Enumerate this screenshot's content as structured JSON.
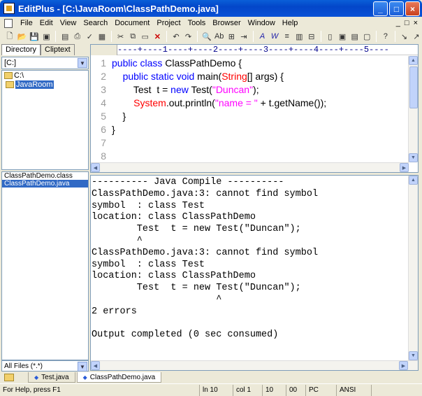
{
  "window": {
    "title": "EditPlus - [C:\\JavaRoom\\ClassPathDemo.java]"
  },
  "menu": [
    "File",
    "Edit",
    "View",
    "Search",
    "Document",
    "Project",
    "Tools",
    "Browser",
    "Window",
    "Help"
  ],
  "mdi_buttons": [
    "_",
    "□",
    "×"
  ],
  "panel": {
    "tabs": [
      "Directory",
      "Cliptext"
    ],
    "drive": "[C:]",
    "tree": [
      "C:\\",
      "JavaRoom"
    ],
    "files": [
      "ClassPathDemo.class",
      "ClassPathDemo.java"
    ],
    "filter": "All Files (*.*)"
  },
  "editor": {
    "ruler": "----+----1----+----2----+----3----+----4----+----5----",
    "line_numbers": [
      "1",
      "2",
      "3",
      "4",
      "5",
      "6",
      "7",
      "8"
    ],
    "lines": [
      {
        "parts": [
          [
            "kw",
            "public class "
          ],
          [
            "",
            "ClassPathDemo {"
          ]
        ]
      },
      {
        "parts": [
          [
            "",
            "    "
          ],
          [
            "kw",
            "public static void "
          ],
          [
            "",
            "main("
          ],
          [
            "cls",
            "String"
          ],
          [
            "",
            "[] args) {"
          ]
        ]
      },
      {
        "parts": [
          [
            "",
            "        Test  t = "
          ],
          [
            "kw",
            "new "
          ],
          [
            "",
            "Test("
          ],
          [
            "str",
            "\"Duncan\""
          ],
          [
            "",
            ");"
          ]
        ]
      },
      {
        "parts": [
          [
            "",
            "        "
          ],
          [
            "cls",
            "System"
          ],
          [
            "",
            ".out.println("
          ],
          [
            "str",
            "\"name = \""
          ],
          [
            "",
            " + t.getName());"
          ]
        ]
      },
      {
        "parts": [
          [
            "",
            "    }"
          ]
        ]
      },
      {
        "parts": [
          [
            "",
            "}"
          ]
        ]
      },
      {
        "parts": [
          [
            "",
            ""
          ]
        ]
      },
      {
        "parts": [
          [
            "",
            ""
          ]
        ]
      }
    ]
  },
  "output": {
    "lines": [
      "---------- Java Compile ----------",
      "ClassPathDemo.java:3: cannot find symbol",
      "symbol  : class Test",
      "location: class ClassPathDemo",
      "        Test  t = new Test(\"Duncan\");",
      "        ^",
      "ClassPathDemo.java:3: cannot find symbol",
      "symbol  : class Test",
      "location: class ClassPathDemo",
      "        Test  t = new Test(\"Duncan\");",
      "                      ^",
      "2 errors",
      "",
      "Output completed (0 sec consumed)"
    ]
  },
  "doc_tabs": [
    "Test.java",
    "ClassPathDemo.java"
  ],
  "status": {
    "help": "For Help, press F1",
    "line": "ln 10",
    "col": "col 1",
    "num": "10",
    "code": "00",
    "mode": "PC",
    "encoding": "ANSI"
  }
}
